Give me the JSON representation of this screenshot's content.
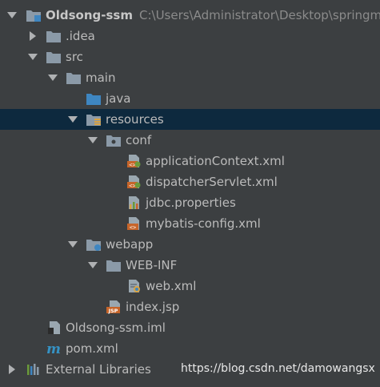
{
  "project": {
    "name": "Oldsong-ssm",
    "path": "C:\\Users\\Administrator\\Desktop\\springm"
  },
  "tree": {
    "idea": ".idea",
    "src": "src",
    "main": "main",
    "java": "java",
    "resources": "resources",
    "conf": "conf",
    "app_context": "applicationContext.xml",
    "dispatcher": "dispatcherServlet.xml",
    "jdbc": "jdbc.properties",
    "mybatis": "mybatis-config.xml",
    "webapp": "webapp",
    "web_inf": "WEB-INF",
    "web_xml": "web.xml",
    "index_jsp": "index.jsp",
    "iml": "Oldsong-ssm.iml",
    "pom": "pom.xml",
    "external_libraries": "External Libraries"
  },
  "watermark": "https://blog.csdn.net/damowangsx",
  "colors": {
    "background": "#3c3f41",
    "selection": "#0d293e",
    "text": "#bbbbbb",
    "folder": "#8b9aa8",
    "source_folder": "#3e86c1",
    "xml_orange": "#c7652a",
    "maven_blue": "#3592c4"
  },
  "icons": {
    "folder": "folder-icon",
    "module": "module-folder-icon",
    "source": "source-folder-icon",
    "resources": "resources-folder-icon",
    "package": "package-folder-icon",
    "web": "web-folder-icon",
    "spring_xml": "spring-xml-icon",
    "properties": "properties-file-icon",
    "xml": "xml-file-icon",
    "web_xml": "web-xml-icon",
    "jsp": "jsp-file-icon",
    "iml": "iml-file-icon",
    "maven": "maven-m-icon",
    "libraries": "libraries-icon"
  }
}
